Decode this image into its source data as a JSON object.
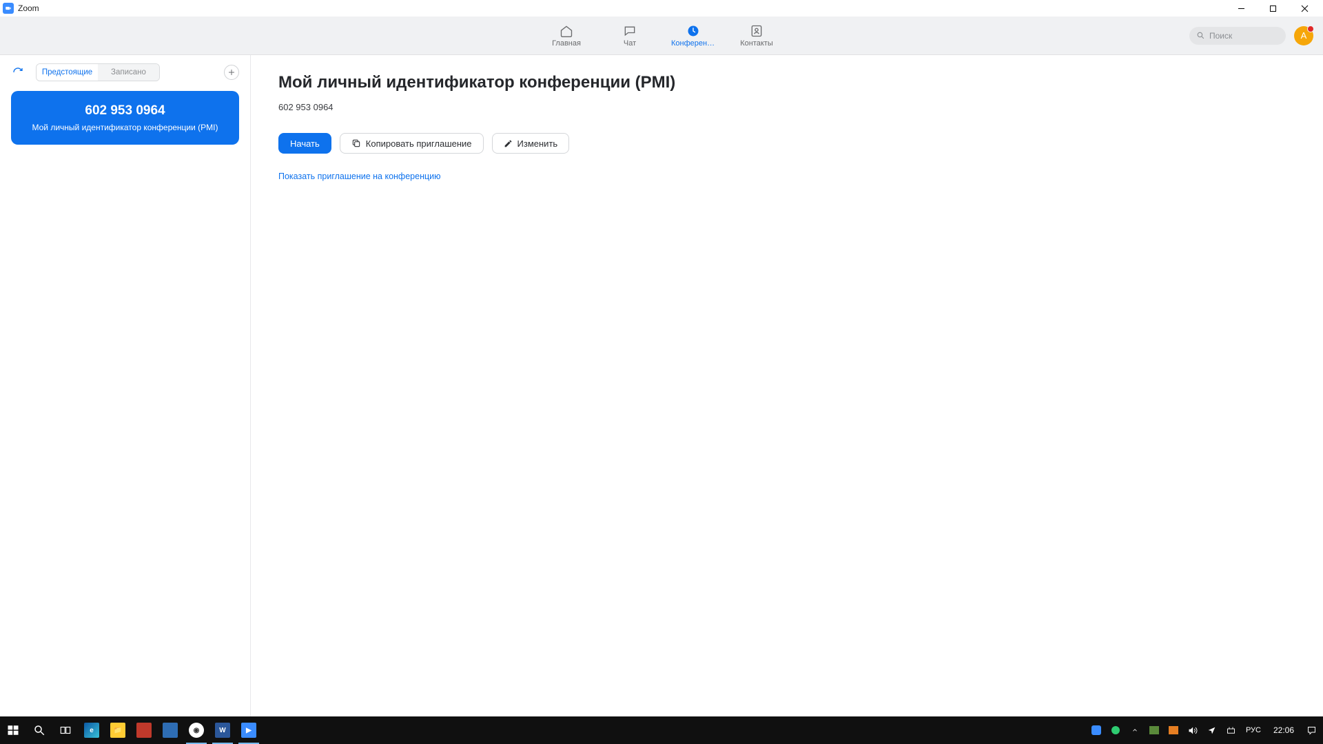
{
  "window": {
    "title": "Zoom"
  },
  "nav": {
    "home": {
      "label": "Главная"
    },
    "chat": {
      "label": "Чат"
    },
    "meet": {
      "label": "Конференц..."
    },
    "contacts": {
      "label": "Контакты"
    }
  },
  "search": {
    "placeholder": "Поиск"
  },
  "avatar": {
    "initial": "A"
  },
  "sidebar": {
    "tabs": {
      "upcoming": "Предстоящие",
      "recorded": "Записано"
    },
    "card": {
      "id": "602 953 0964",
      "subtitle": "Мой личный идентификатор конференции (PMI)"
    }
  },
  "main": {
    "title": "Мой личный идентификатор конференции (PMI)",
    "meeting_id": "602 953 0964",
    "buttons": {
      "start": "Начать",
      "copy": "Копировать приглашение",
      "edit": "Изменить"
    },
    "show_invite": "Показать приглашение на конференцию"
  },
  "taskbar": {
    "language": "РУС",
    "clock": "22:06"
  }
}
